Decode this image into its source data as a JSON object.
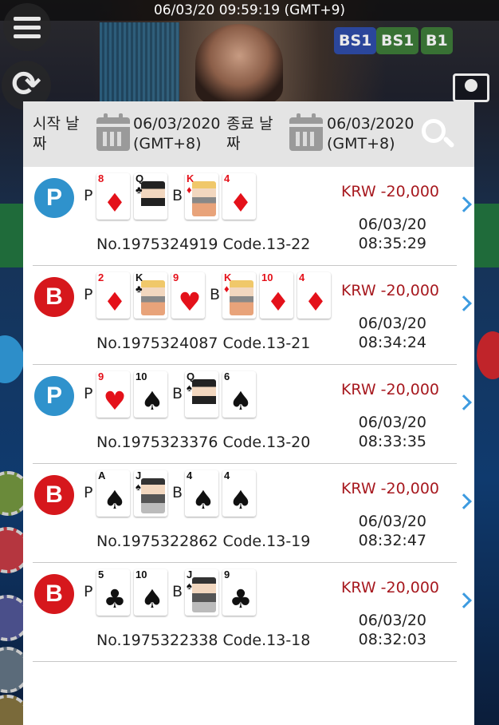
{
  "status": {
    "datetime": "06/03/20 09:59:19 (GMT+9)"
  },
  "top_tags": [
    {
      "label": "BS1",
      "color": "#2b4aa8"
    },
    {
      "label": "BS1",
      "color": "#3b7a35"
    },
    {
      "label": "B1",
      "color": "#3b7a35"
    }
  ],
  "filter": {
    "start_label": "시작 날짜",
    "start_date": "06/03/2020",
    "start_tz": "(GMT+8)",
    "end_label": "종료 날짜",
    "end_date": "06/03/2020",
    "end_tz": "(GMT+8)"
  },
  "colors": {
    "player": "#2f92cc",
    "banker": "#d6171c",
    "amount": "#a7191f",
    "chevron": "#3d9be0"
  },
  "rows": [
    {
      "result": "P",
      "player_label": "P",
      "banker_label": "B",
      "player_cards": [
        {
          "rank": "8",
          "suit": "♦"
        },
        {
          "rank": "Q",
          "suit": "♣"
        }
      ],
      "banker_cards": [
        {
          "rank": "K",
          "suit": "♦"
        },
        {
          "rank": "4",
          "suit": "♦"
        }
      ],
      "round": "No.1975324919 Code.13-22",
      "amount": "KRW -20,000",
      "date": "06/03/20",
      "time": "08:35:29"
    },
    {
      "result": "B",
      "player_label": "P",
      "banker_label": "B",
      "player_cards": [
        {
          "rank": "2",
          "suit": "♦"
        },
        {
          "rank": "K",
          "suit": "♣"
        },
        {
          "rank": "9",
          "suit": "♥"
        }
      ],
      "banker_cards": [
        {
          "rank": "K",
          "suit": "♦"
        },
        {
          "rank": "10",
          "suit": "♦"
        },
        {
          "rank": "4",
          "suit": "♦"
        }
      ],
      "round": "No.1975324087 Code.13-21",
      "amount": "KRW -20,000",
      "date": "06/03/20",
      "time": "08:34:24"
    },
    {
      "result": "P",
      "player_label": "P",
      "banker_label": "B",
      "player_cards": [
        {
          "rank": "9",
          "suit": "♥"
        },
        {
          "rank": "10",
          "suit": "♠"
        }
      ],
      "banker_cards": [
        {
          "rank": "Q",
          "suit": "♠"
        },
        {
          "rank": "6",
          "suit": "♠"
        }
      ],
      "round": "No.1975323376 Code.13-20",
      "amount": "KRW -20,000",
      "date": "06/03/20",
      "time": "08:33:35"
    },
    {
      "result": "B",
      "player_label": "P",
      "banker_label": "B",
      "player_cards": [
        {
          "rank": "A",
          "suit": "♠"
        },
        {
          "rank": "J",
          "suit": "♠"
        }
      ],
      "banker_cards": [
        {
          "rank": "4",
          "suit": "♠"
        },
        {
          "rank": "4",
          "suit": "♠"
        }
      ],
      "round": "No.1975322862 Code.13-19",
      "amount": "KRW -20,000",
      "date": "06/03/20",
      "time": "08:32:47"
    },
    {
      "result": "B",
      "player_label": "P",
      "banker_label": "B",
      "player_cards": [
        {
          "rank": "5",
          "suit": "♣"
        },
        {
          "rank": "10",
          "suit": "♠"
        }
      ],
      "banker_cards": [
        {
          "rank": "J",
          "suit": "♠"
        },
        {
          "rank": "9",
          "suit": "♣"
        }
      ],
      "round": "No.1975322338 Code.13-18",
      "amount": "KRW -20,000",
      "date": "06/03/20",
      "time": "08:32:03"
    }
  ]
}
